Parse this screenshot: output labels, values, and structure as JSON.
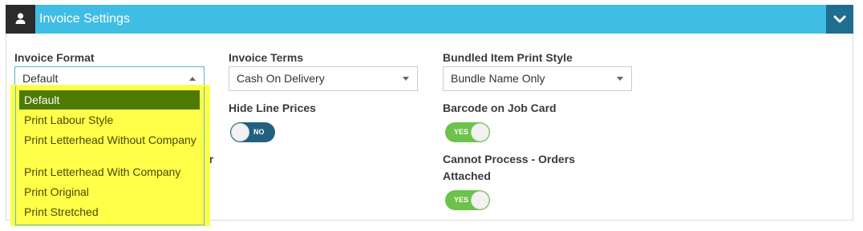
{
  "header": {
    "title": "Invoice Settings",
    "user_icon": "user-icon",
    "collapse_icon": "chevron-down-icon",
    "color": "#3fbde5"
  },
  "invoice_format": {
    "label": "Invoice Format",
    "selected": "Default",
    "options": [
      "Default",
      "Print Labour Style",
      "Print Letterhead Without Company",
      "Print Letterhead With Company",
      "Print Original",
      "Print Stretched"
    ]
  },
  "invoice_terms": {
    "label": "Invoice Terms",
    "selected": "Cash On Delivery"
  },
  "bundled_item_print_style": {
    "label": "Bundled Item Print Style",
    "selected": "Bundle Name Only"
  },
  "hide_line_prices": {
    "label": "Hide Line Prices",
    "state": "NO"
  },
  "barcode_on_job_card": {
    "label": "Barcode on Job Card",
    "state": "YES"
  },
  "cannot_process_orders": {
    "label_line1": "Cannot Process - Orders",
    "label_line2": "Attached",
    "state": "YES"
  },
  "obscured_label_fragment": "er",
  "colors": {
    "toggle_on": "#6cc24a",
    "toggle_off": "#22607f",
    "highlight": "#ffff4a",
    "selected_option": "#4f7a06"
  }
}
